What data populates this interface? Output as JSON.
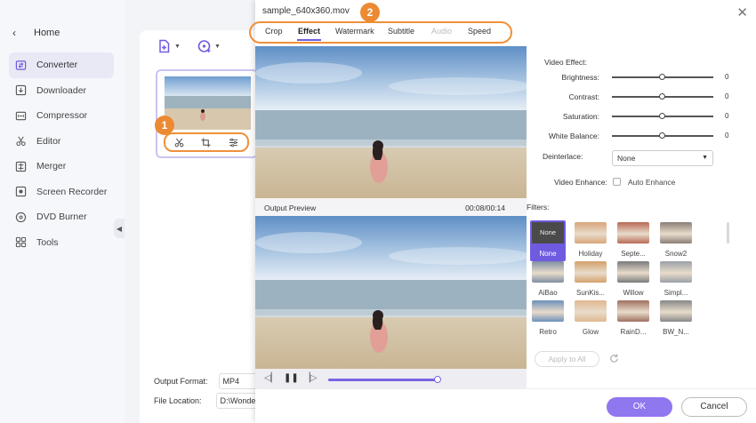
{
  "sidebar": {
    "home_label": "Home",
    "items": [
      {
        "label": "Converter",
        "icon": "converter-icon",
        "active": true
      },
      {
        "label": "Downloader",
        "icon": "downloader-icon"
      },
      {
        "label": "Compressor",
        "icon": "compressor-icon"
      },
      {
        "label": "Editor",
        "icon": "editor-icon"
      },
      {
        "label": "Merger",
        "icon": "merger-icon"
      },
      {
        "label": "Screen Recorder",
        "icon": "screen-recorder-icon"
      },
      {
        "label": "DVD Burner",
        "icon": "dvd-burner-icon"
      },
      {
        "label": "Tools",
        "icon": "tools-icon"
      }
    ]
  },
  "annotations": {
    "badge1": "1",
    "badge2": "2"
  },
  "output": {
    "format_label": "Output Format:",
    "format_value": "MP4",
    "location_label": "File Location:",
    "location_value": "D:\\Wondersh"
  },
  "dialog": {
    "title": "sample_640x360.mov",
    "close": "✕",
    "tabs": [
      {
        "label": "Crop"
      },
      {
        "label": "Effect",
        "active": true
      },
      {
        "label": "Watermark"
      },
      {
        "label": "Subtitle"
      },
      {
        "label": "Audio",
        "disabled": true
      },
      {
        "label": "Speed"
      }
    ],
    "preview": {
      "output_label": "Output Preview",
      "time": "00:08/00:14",
      "progress": 0.98
    },
    "video_effect": {
      "title": "Video Effect:",
      "sliders": [
        {
          "label": "Brightness:",
          "value": "0",
          "position": 0.5
        },
        {
          "label": "Contrast:",
          "value": "0",
          "position": 0.5
        },
        {
          "label": "Saturation:",
          "value": "0",
          "position": 0.5
        },
        {
          "label": "White Balance:",
          "value": "0",
          "position": 0.5
        }
      ],
      "deinterlace_label": "Deinterlace:",
      "deinterlace_value": "None",
      "enhance_label": "Video Enhance:",
      "enhance_option": "Auto Enhance"
    },
    "filters": {
      "title": "Filters:",
      "items": [
        {
          "name": "None",
          "thumb_text": "None",
          "selected": true
        },
        {
          "name": "Holiday",
          "tint": "#d9a57a"
        },
        {
          "name": "Septe...",
          "tint": "#b86a55"
        },
        {
          "name": "Snow2",
          "tint": "#8a7f76"
        },
        {
          "name": "AiBao",
          "tint": "#7f8ea3"
        },
        {
          "name": "SunKis...",
          "tint": "#d3a06b"
        },
        {
          "name": "Willow",
          "tint": "#7a7a7a"
        },
        {
          "name": "Simpl...",
          "tint": "#9aa0a8"
        },
        {
          "name": "Retro",
          "tint": "#6d8fb8"
        },
        {
          "name": "Glow",
          "tint": "#e0b890"
        },
        {
          "name": "RainD...",
          "tint": "#a07060"
        },
        {
          "name": "BW_N...",
          "tint": "#888888"
        }
      ]
    },
    "apply_all": "Apply to All",
    "ok": "OK",
    "cancel": "Cancel"
  }
}
